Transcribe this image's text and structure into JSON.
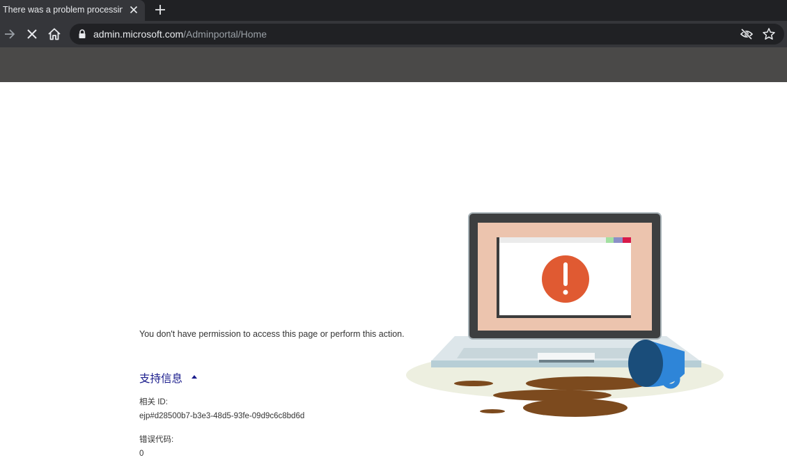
{
  "browser": {
    "tab_title": "There was a problem processing",
    "url_host": "admin.microsoft.com",
    "url_path": "/Adminportal/Home"
  },
  "page": {
    "message": "You don't have permission to access this page or perform this action.",
    "support_info_label": "支持信息",
    "correlation_id_label": "相关 ID:",
    "correlation_id_value": "ejp#d28500b7-b3e3-48d5-93fe-09d9c6c8bd6d",
    "error_code_label": "错误代码:",
    "error_code_value": "0"
  },
  "colors": {
    "banner": "#4a4948",
    "link": "#1a1c8c",
    "alert": "#e05a32"
  },
  "icons": [
    "forward-icon",
    "stop-icon",
    "home-icon",
    "lock-icon",
    "eye-off-icon",
    "star-icon",
    "close-icon",
    "plus-icon",
    "caret-up-icon"
  ]
}
